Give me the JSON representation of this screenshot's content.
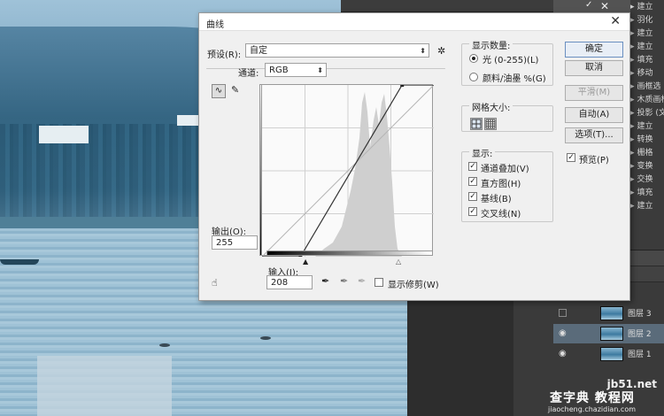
{
  "dialog": {
    "title": "曲线",
    "preset_label": "预设(R):",
    "preset_value": "自定",
    "channel_label": "通道:",
    "channel_value": "RGB",
    "output_label": "输出(O):",
    "output_value": "255",
    "input_label": "输入(I):",
    "input_value": "208",
    "show_clipping": "显示修剪(W)",
    "display_amount": {
      "caption": "显示数量:",
      "light": "光 (0-255)(L)",
      "pigment": "颜料/油墨 %(G)"
    },
    "grid_size": {
      "caption": "网格大小:"
    },
    "show": {
      "caption": "显示:",
      "overlay": "通道叠加(V)",
      "histogram": "直方图(H)",
      "baseline": "基线(B)",
      "intersection": "交叉线(N)"
    },
    "buttons": {
      "ok": "确定",
      "cancel": "取消",
      "smooth": "平滑(M)",
      "auto": "自动(A)",
      "options": "选项(T)..."
    },
    "preview": "预览(P)"
  },
  "curve": {
    "input_range": [
      0,
      255
    ],
    "output_range": [
      0,
      255
    ],
    "points": [
      [
        57,
        0
      ],
      [
        208,
        255
      ]
    ]
  },
  "history_panel": {
    "items": [
      "建立",
      "羽化",
      "建立",
      "建立",
      "填充",
      "移动",
      "画框选",
      "木质画框",
      "投影 (文",
      "建立",
      "转换",
      "栅格",
      "变换",
      "交换",
      "填充",
      "建立"
    ]
  },
  "layers_panel": {
    "layers": [
      "图层 3",
      "图层 2",
      "图层 1"
    ]
  },
  "watermark": {
    "site": "jb51.net",
    "name": "查字典 教程网",
    "url": "jiaocheng.chazidian.com"
  },
  "colors": {
    "accent": "#6a8fc0",
    "dialog_bg": "#f0f0f0",
    "histogram": "#cfcfcf"
  }
}
